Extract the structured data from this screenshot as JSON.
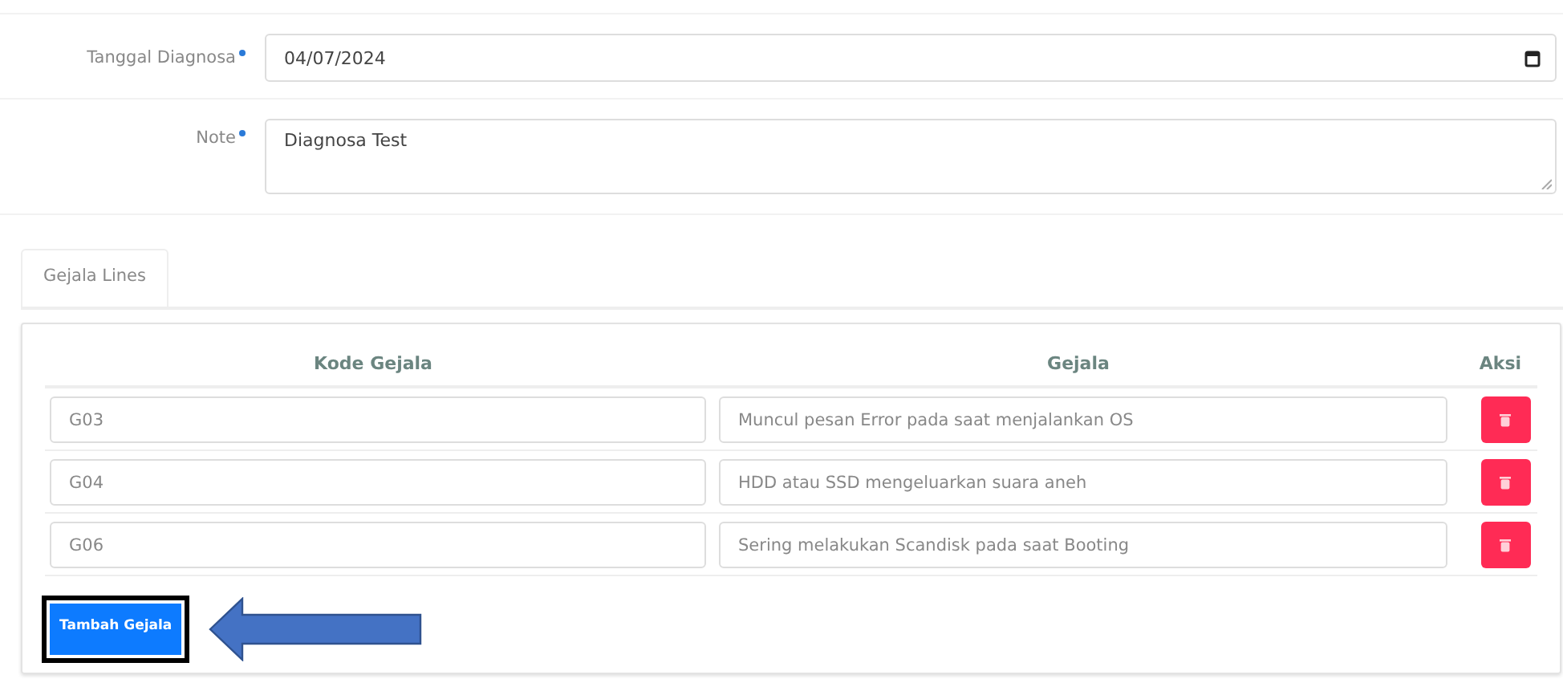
{
  "form_fields": [
    {
      "label": "Tanggal Diagnosa",
      "required": true,
      "kind": "date",
      "value": "04/07/2024"
    },
    {
      "label": "Note",
      "required": true,
      "kind": "textarea",
      "value": "Diagnosa Test"
    }
  ],
  "tabs": [
    {
      "label": "Gejala Lines",
      "selected": true
    }
  ],
  "table": {
    "columns": [
      "Kode Gejala",
      "Gejala",
      "Aksi"
    ],
    "rows": [
      {
        "kode": "G03",
        "gejala": "Muncul pesan Error pada saat menjalankan OS"
      },
      {
        "kode": "G04",
        "gejala": "HDD atau SSD mengeluarkan suara aneh"
      },
      {
        "kode": "G06",
        "gejala": "Sering melakukan Scandisk pada saat Booting"
      }
    ]
  },
  "add_button": {
    "label": "Tambah Gejala",
    "highlighted": true
  }
}
